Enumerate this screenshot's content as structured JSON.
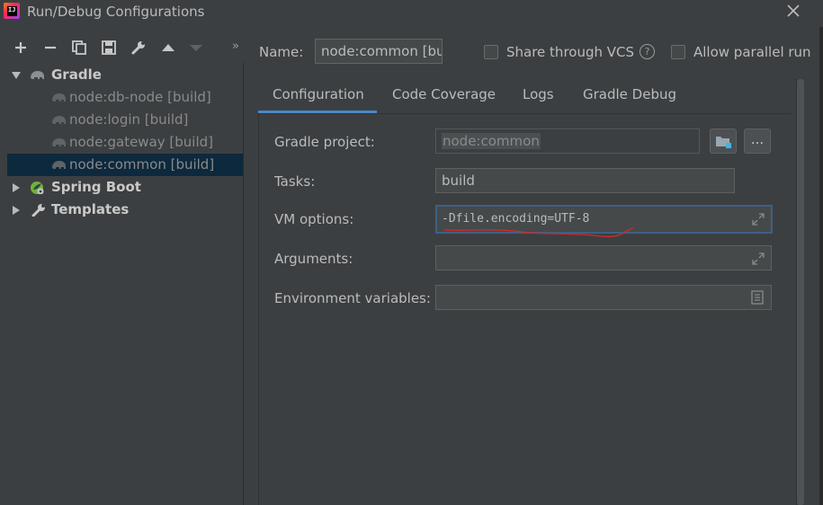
{
  "window": {
    "title": "Run/Debug Configurations",
    "app_icon_text": "IJ"
  },
  "toolbar": {
    "more_label": "»"
  },
  "tree": {
    "items": [
      {
        "label": "Gradle",
        "icon": "gradle-elephant-icon",
        "expanded": true
      },
      {
        "label": "node:db-node [build]",
        "icon": "gradle-elephant-icon"
      },
      {
        "label": "node:login [build]",
        "icon": "gradle-elephant-icon"
      },
      {
        "label": "node:gateway [build]",
        "icon": "gradle-elephant-icon"
      },
      {
        "label": "node:common [build]",
        "icon": "gradle-elephant-icon",
        "selected": true
      },
      {
        "label": "Spring Boot",
        "icon": "spring-boot-icon",
        "expanded": false
      },
      {
        "label": "Templates",
        "icon": "wrench-icon",
        "expanded": false
      }
    ]
  },
  "header": {
    "name_label": "Name:",
    "name_value": "node:common [build]",
    "share_vcs_label": "Share through VCS",
    "share_vcs_checked": false,
    "help_label": "?",
    "allow_parallel_label": "Allow parallel run",
    "allow_parallel_checked": false
  },
  "tabs": [
    {
      "label": "Configuration",
      "active": true
    },
    {
      "label": "Code Coverage"
    },
    {
      "label": "Logs"
    },
    {
      "label": "Gradle Debug"
    }
  ],
  "form": {
    "gradle_project_label": "Gradle project:",
    "gradle_project_value": "node:common",
    "browse_button_label": "...",
    "tasks_label": "Tasks:",
    "tasks_value": "build",
    "vm_options_label": "VM options:",
    "vm_options_value": "-Dfile.encoding=UTF-8",
    "arguments_label": "Arguments:",
    "arguments_value": "",
    "env_vars_label": "Environment variables:",
    "env_vars_value": ""
  },
  "colors": {
    "background": "#3c3f41",
    "selection": "#0d293e",
    "accent": "#4a88c7",
    "annotation_red": "#d22a2a"
  }
}
